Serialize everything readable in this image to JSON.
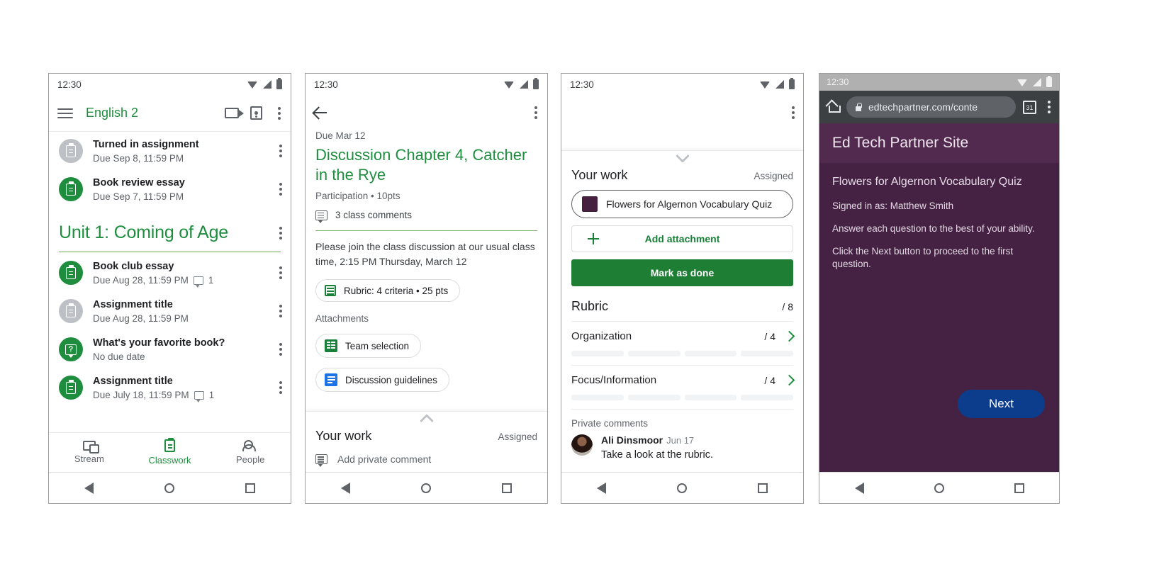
{
  "panel1": {
    "status": {
      "time": "12:30"
    },
    "appbar": {
      "title": "English 2",
      "menu_icon": "hamburger-icon",
      "meet_icon": "video-call-icon",
      "class_icon": "class-card-icon",
      "overflow_icon": "kebab-menu-icon"
    },
    "upcoming": [
      {
        "title": "Turned in assignment",
        "subtitle": "Due Sep 8, 11:59 PM",
        "icon": "assignment-icon",
        "state": "grey",
        "comments": ""
      },
      {
        "title": "Book review essay",
        "subtitle": "Due Sep 7, 11:59 PM",
        "icon": "assignment-icon",
        "state": "green",
        "comments": ""
      }
    ],
    "topic": {
      "title": "Unit 1: Coming of Age"
    },
    "items": [
      {
        "title": "Book club essay",
        "subtitle": "Due Aug 28, 11:59 PM",
        "icon": "assignment-icon",
        "state": "green",
        "comments": "1"
      },
      {
        "title": "Assignment title",
        "subtitle": "Due Aug 28, 11:59 PM",
        "icon": "assignment-icon",
        "state": "grey",
        "comments": ""
      },
      {
        "title": "What's your favorite book?",
        "subtitle": "No due date",
        "icon": "question-icon",
        "state": "green",
        "comments": ""
      },
      {
        "title": "Assignment title",
        "subtitle": "Due July 18, 11:59 PM",
        "icon": "assignment-icon",
        "state": "green",
        "comments": "1"
      }
    ],
    "tabs": [
      {
        "label": "Stream",
        "icon": "stream-icon",
        "active": false
      },
      {
        "label": "Classwork",
        "icon": "classwork-icon",
        "active": true
      },
      {
        "label": "People",
        "icon": "people-icon",
        "active": false
      }
    ]
  },
  "panel2": {
    "status": {
      "time": "12:30"
    },
    "back_icon": "back-arrow-icon",
    "overflow_icon": "kebab-menu-icon",
    "due": "Due Mar 12",
    "title": "Discussion Chapter 4, Catcher in the Rye",
    "meta": "Participation • 10pts",
    "class_comments": "3 class comments",
    "description": "Please join the class discussion at our usual class time, 2:15 PM Thursday, March 12",
    "rubric_chip": "Rubric: 4 criteria • 25 pts",
    "attachments_label": "Attachments",
    "attachments": [
      {
        "name": "Team selection",
        "icon": "google-sheets-icon"
      },
      {
        "name": "Discussion guidelines",
        "icon": "google-docs-icon"
      }
    ],
    "your_work": {
      "title": "Your work",
      "status": "Assigned",
      "private_comment_placeholder": "Add private comment"
    }
  },
  "panel3": {
    "status": {
      "time": "12:30"
    },
    "overflow_icon": "kebab-menu-icon",
    "your_work": {
      "title": "Your work",
      "status": "Assigned"
    },
    "attachment": {
      "name": "Flowers for Algernon Vocabulary Quiz",
      "thumb_color": "#45203f"
    },
    "add_attachment_label": "Add attachment",
    "mark_done_label": "Mark as done",
    "rubric": {
      "title": "Rubric",
      "total": "/ 8"
    },
    "criteria": [
      {
        "name": "Organization",
        "score": "/ 4",
        "levels": 4
      },
      {
        "name": "Focus/Information",
        "score": "/ 4",
        "levels": 4
      }
    ],
    "private_comments": {
      "label": "Private comments",
      "author": "Ali Dinsmoor",
      "date": "Jun 17",
      "text": "Take a look at the rubric."
    }
  },
  "panel4": {
    "status": {
      "time": "12:30"
    },
    "browser": {
      "home_icon": "home-icon",
      "lock_icon": "lock-icon",
      "url": "edtechpartner.com/conte",
      "tabs_icon": "tab-count-icon",
      "tabs_count": "31",
      "overflow_icon": "kebab-menu-icon"
    },
    "site_header": "Ed Tech Partner Site",
    "quiz_title": "Flowers for Algernon Vocabulary Quiz",
    "signed_in": "Signed in as: Matthew Smith",
    "line1": "Answer each question to the best of your ability.",
    "line2": "Click the Next button to proceed to the first question.",
    "next_label": "Next",
    "colors": {
      "page_bg": "#452244",
      "header_bg": "#522a50",
      "button": "#0b3d8c"
    }
  }
}
